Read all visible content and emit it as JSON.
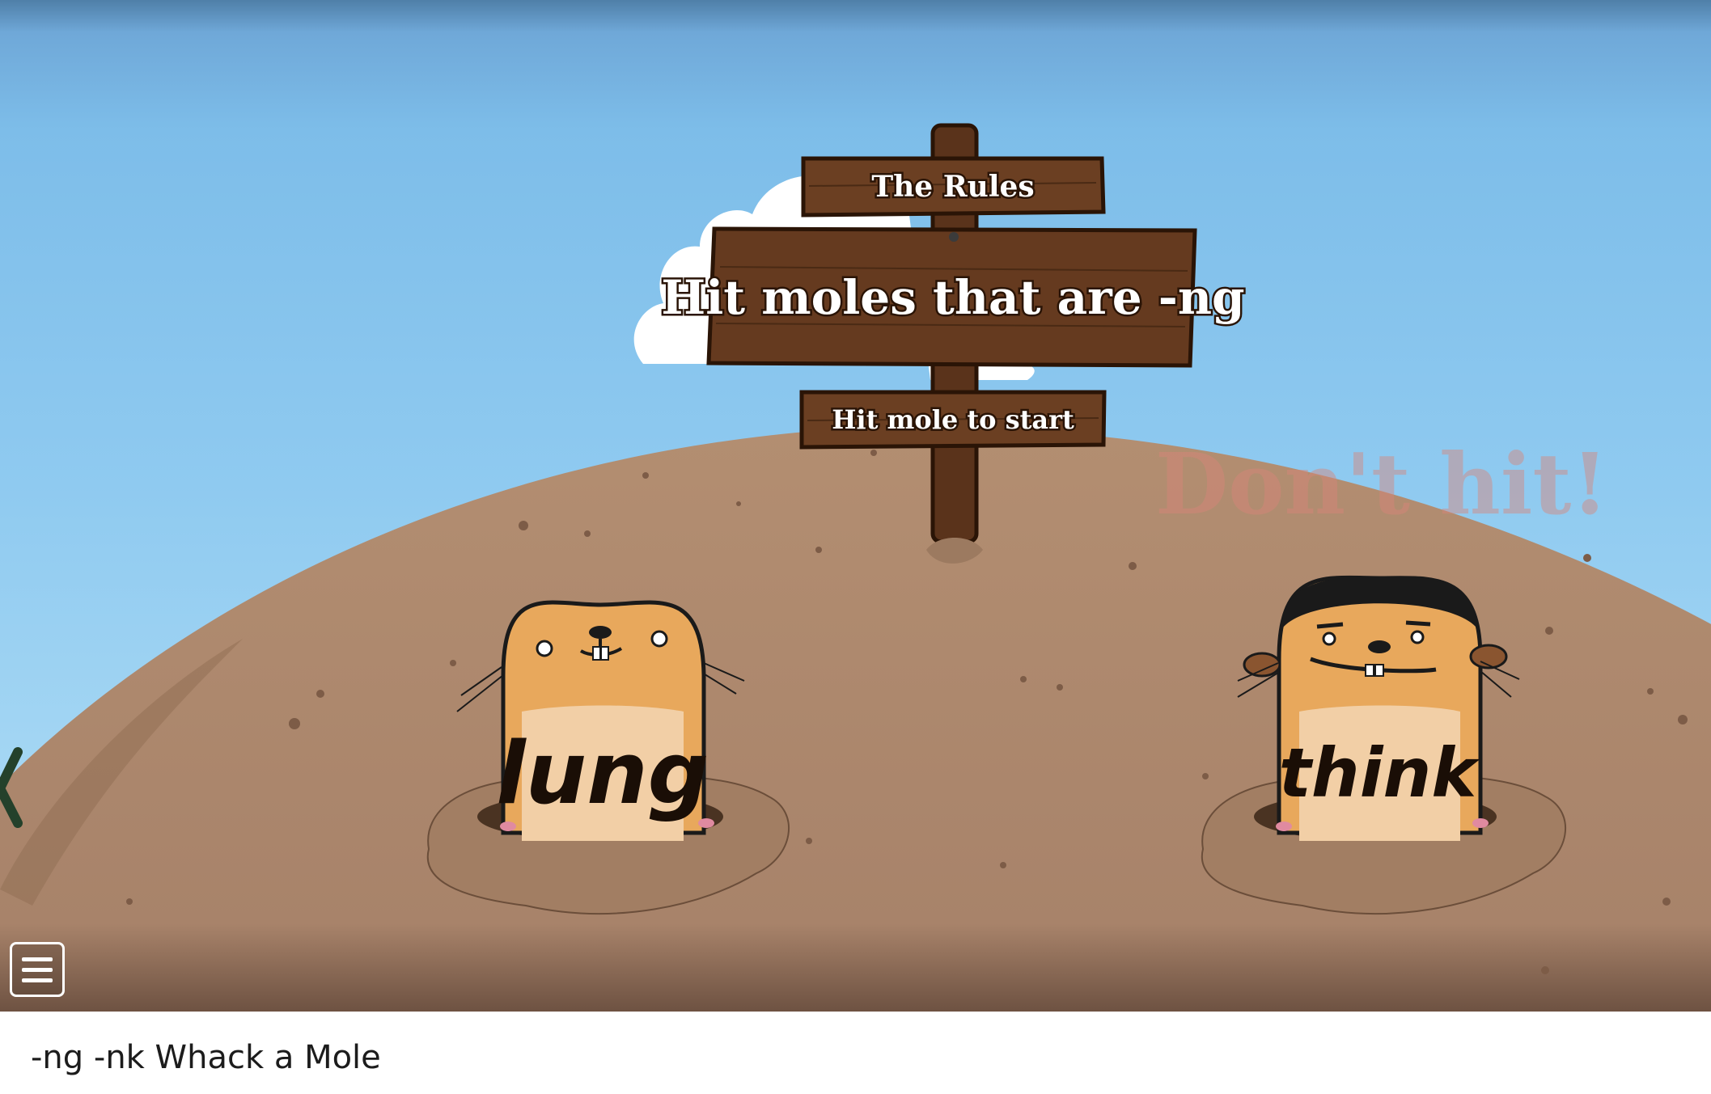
{
  "signpost": {
    "title": "The Rules",
    "rule": "Hit moles that are -ng",
    "instruction": "Hit mole to start"
  },
  "warning_label": "Don't hit!",
  "moles": [
    {
      "word": "lung"
    },
    {
      "word": "think"
    }
  ],
  "menu": {
    "icon": "hamburger-menu-icon"
  },
  "page_caption": "-ng -nk Whack a Mole",
  "colors": {
    "sky": "#7dbde9",
    "hill": "#b08a6c",
    "wood": "#5a331b",
    "mole": "#e8a85c",
    "mole_belly": "#f2cfa6",
    "warning": "#d9857a"
  }
}
